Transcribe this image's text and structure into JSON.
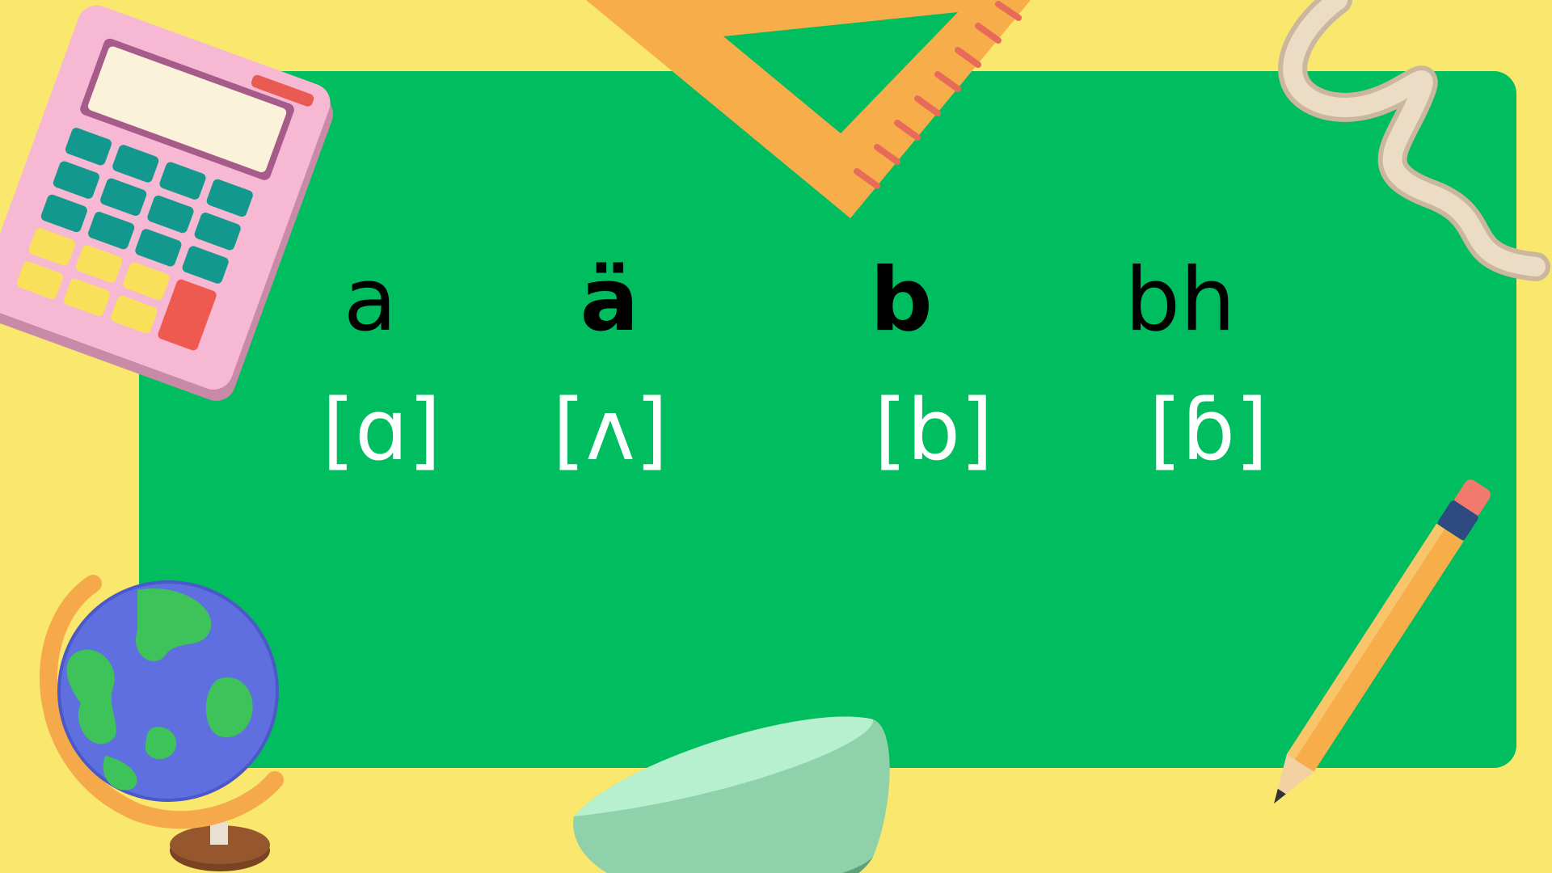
{
  "slide": {
    "columns": [
      {
        "letter": "a",
        "ipa": "[ɑ]",
        "bold": false
      },
      {
        "letter": "ä",
        "ipa": "[ʌ]",
        "bold": true
      },
      {
        "letter": "b",
        "ipa": "[b]",
        "bold": true
      },
      {
        "letter": "bh",
        "ipa": "[ɓ]",
        "bold": false
      }
    ]
  },
  "decorations": [
    "calculator-illustration",
    "set-square-ruler-illustration",
    "squiggle-illustration",
    "globe-illustration",
    "half-sphere-illustration",
    "pencil-illustration"
  ],
  "colors": {
    "background": "#f9e76e",
    "board": "#00bd5f",
    "letter": "#000000",
    "ipa": "#ffffff"
  }
}
